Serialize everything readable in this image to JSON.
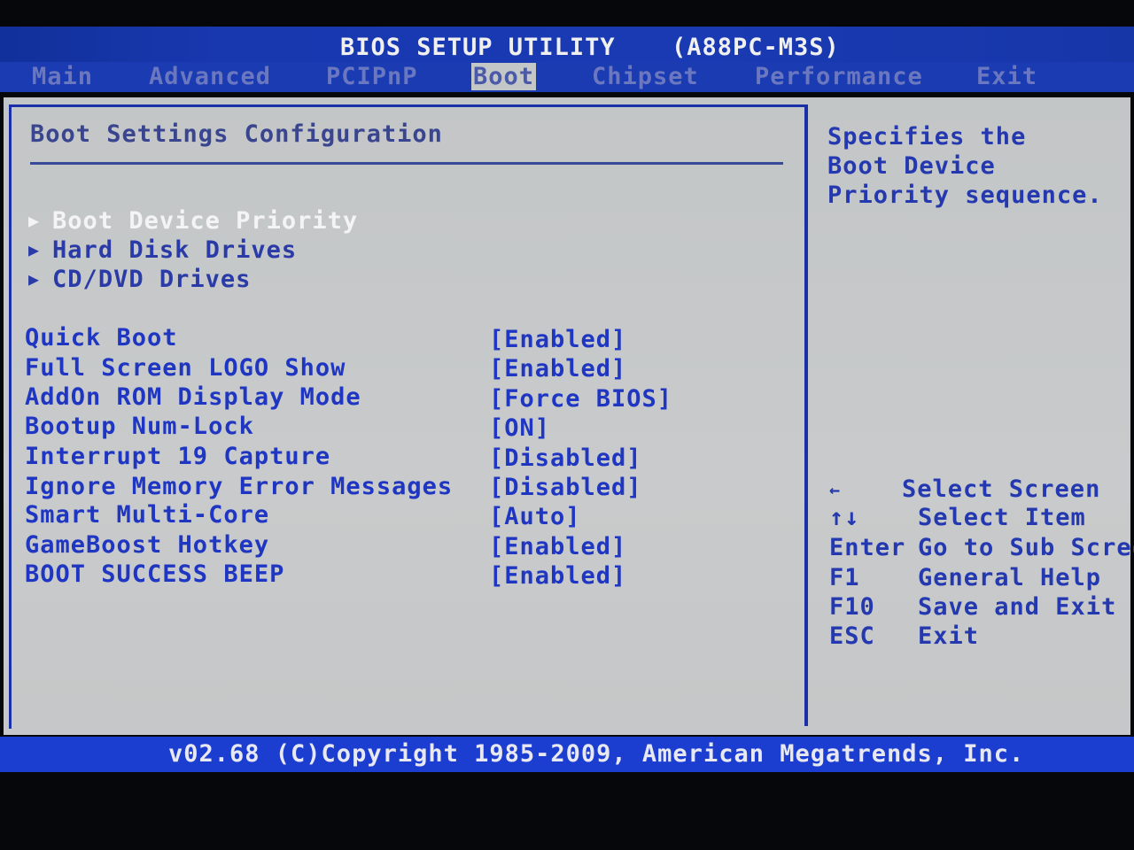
{
  "header": {
    "title": "BIOS SETUP UTILITY",
    "model": "(A88PC-M3S)"
  },
  "tabs": [
    {
      "label": "Main"
    },
    {
      "label": "Advanced"
    },
    {
      "label": "PCIPnP"
    },
    {
      "label": "Boot",
      "active": true
    },
    {
      "label": "Chipset"
    },
    {
      "label": "Performance"
    },
    {
      "label": "Exit"
    }
  ],
  "main": {
    "section_title": "Boot Settings Configuration",
    "submenus": [
      {
        "label": "Boot Device Priority",
        "selected": true
      },
      {
        "label": "Hard Disk Drives"
      },
      {
        "label": "CD/DVD Drives"
      }
    ],
    "settings": [
      {
        "label": "Quick Boot",
        "value": "[Enabled]"
      },
      {
        "label": "Full Screen LOGO Show",
        "value": "[Enabled]"
      },
      {
        "label": "AddOn ROM Display Mode",
        "value": "[Force BIOS]"
      },
      {
        "label": "Bootup Num-Lock",
        "value": "[ON]"
      },
      {
        "label": "Interrupt 19 Capture",
        "value": "[Disabled]"
      },
      {
        "label": "Ignore Memory Error Messages",
        "value": "[Disabled]"
      },
      {
        "label": "Smart Multi-Core",
        "value": "[Auto]"
      },
      {
        "label": "GameBoost Hotkey",
        "value": "[Enabled]"
      },
      {
        "label": "BOOT SUCCESS BEEP",
        "value": "[Enabled]"
      }
    ]
  },
  "help": {
    "lines": [
      "Specifies the",
      "Boot Device",
      "Priority sequence."
    ]
  },
  "keys": [
    {
      "key": "←",
      "desc": "Select Screen"
    },
    {
      "key": "↑↓",
      "desc": "Select Item"
    },
    {
      "key": "Enter",
      "desc": "Go to Sub Scree"
    },
    {
      "key": "F1",
      "desc": "General Help"
    },
    {
      "key": "F10",
      "desc": "Save and Exit"
    },
    {
      "key": "ESC",
      "desc": "Exit"
    }
  ],
  "footer": {
    "text": "v02.68 (C)Copyright 1985-2009, American Megatrends, Inc."
  },
  "colors": {
    "bar_blue": "#1a3bb2",
    "panel_gray": "#c5c7c8",
    "text_blue": "#1f36c2",
    "selected_white": "#f4f4f4"
  }
}
